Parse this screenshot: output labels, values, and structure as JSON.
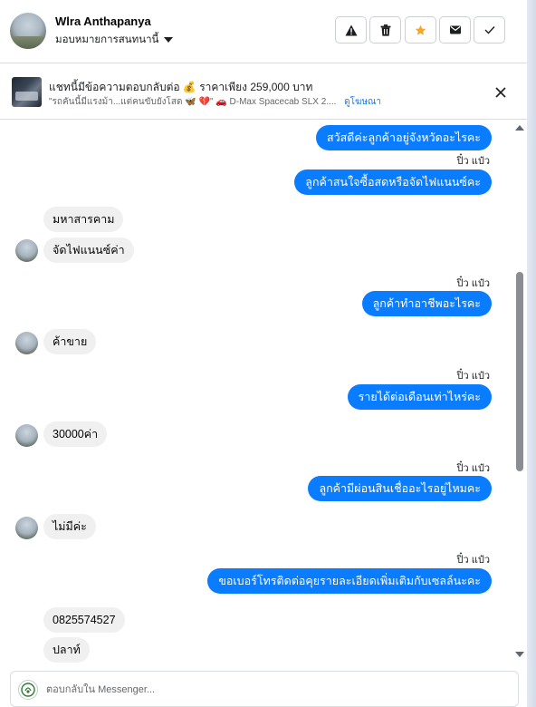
{
  "header": {
    "user_name": "Wlra Anthapanya",
    "assign_label": "มอบหมายการสนทนานี้",
    "actions": [
      "report",
      "delete",
      "star",
      "mark-unread",
      "done"
    ],
    "colors": {
      "star": "#f5a623",
      "icon": "#1c1e21"
    }
  },
  "ad": {
    "title": "แชทนี้มีข้อความตอบกลับต่อ 💰 ราคาเพียง 259,000 บาท",
    "subtitle": "\"รถคันนี้มีแรงม้า...แต่คนขับยังโสด 🦋 💔\" 🚗 D-Max Spacecab SLX 2....",
    "link": "ดูโฆษณา"
  },
  "messages": [
    {
      "dir": "out",
      "text": "สวัสดีค่ะลูกค้าอยู่จังหวัดอะไรคะ"
    },
    {
      "dir": "sender",
      "text": "ปิ๋ว แป๋ว"
    },
    {
      "dir": "out",
      "text": "ลูกค้าสนใจซื้อสดหรือจัดไฟแนนซ์คะ"
    },
    {
      "dir": "in",
      "text": "มหาสารคาม"
    },
    {
      "dir": "in",
      "text": "จัดไฟแนนซ์ค่า"
    },
    {
      "dir": "sender",
      "text": "ปิ๋ว แป๋ว"
    },
    {
      "dir": "out",
      "text": "ลูกค้าทำอาชีพอะไรคะ"
    },
    {
      "dir": "in",
      "text": "ค้าขาย"
    },
    {
      "dir": "sender",
      "text": "ปิ๋ว แป๋ว"
    },
    {
      "dir": "out",
      "text": "รายได้ต่อเดือนเท่าไหร่คะ"
    },
    {
      "dir": "in",
      "text": "30000ค่า"
    },
    {
      "dir": "sender",
      "text": "ปิ๋ว แป๋ว"
    },
    {
      "dir": "out",
      "text": "ลูกค้ามีผ่อนสินเชื่ออะไรอยู่ไหมคะ"
    },
    {
      "dir": "in",
      "text": "ไม่มีค่ะ"
    },
    {
      "dir": "sender",
      "text": "ปิ๋ว แป๋ว"
    },
    {
      "dir": "out",
      "text": "ขอเบอร์โทรติดต่อคุยรายละเอียดเพิ่มเติมกับเซลล์นะคะ"
    },
    {
      "dir": "in",
      "text": "0825574527"
    },
    {
      "dir": "in",
      "text": "ปลาท์"
    }
  ],
  "composer": {
    "placeholder": "ตอบกลับใน Messenger..."
  },
  "colors": {
    "outgoing_bubble": "#0a7cff",
    "incoming_bubble": "#f0f0f0"
  }
}
